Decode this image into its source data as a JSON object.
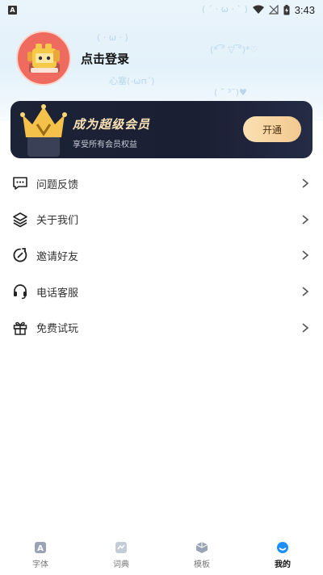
{
  "status_bar": {
    "time": "3:43",
    "notification_icon": "letter-a-badge-icon",
    "icons": [
      "wifi-icon",
      "signal-off-icon",
      "battery-charging-icon"
    ]
  },
  "profile": {
    "login_text": "点击登录",
    "avatar_icon": "robot-avatar-icon"
  },
  "vip": {
    "title": "成为超级会员",
    "subtitle": "享受所有会员权益",
    "button_label": "开通",
    "icon": "crown-v-icon",
    "colors": {
      "card": "#1d2337",
      "title": "#fbe3b5",
      "button": "#f2c98f"
    }
  },
  "menu": {
    "items": [
      {
        "label": "问题反馈",
        "icon": "feedback-icon"
      },
      {
        "label": "关于我们",
        "icon": "layers-icon"
      },
      {
        "label": "邀请好友",
        "icon": "refresh-icon"
      },
      {
        "label": "电话客服",
        "icon": "headset-icon"
      },
      {
        "label": "免费试玩",
        "icon": "gift-icon"
      }
    ]
  },
  "tabbar": {
    "tabs": [
      {
        "label": "字体",
        "icon": "font-icon",
        "active": false
      },
      {
        "label": "词典",
        "icon": "dictionary-icon",
        "active": false
      },
      {
        "label": "模板",
        "icon": "template-icon",
        "active": false
      },
      {
        "label": "我的",
        "icon": "profile-icon",
        "active": true
      }
    ],
    "accent_color": "#1e8ef5"
  }
}
